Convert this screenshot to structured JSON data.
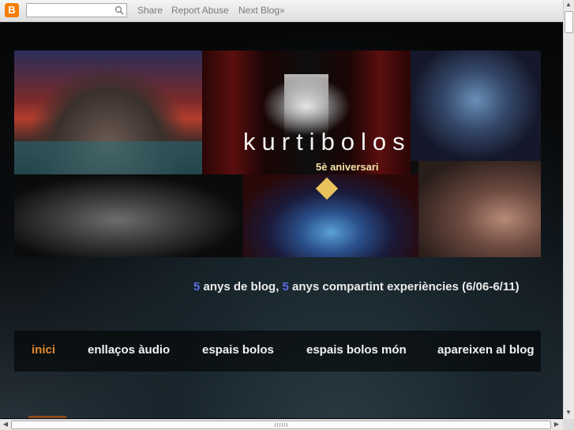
{
  "navbar": {
    "logo_letter": "B",
    "search_placeholder": "",
    "links": [
      "Share",
      "Report Abuse",
      "Next Blog»"
    ]
  },
  "header": {
    "title": "kurtibolos",
    "subtitle": "5è aniversari"
  },
  "tagline": {
    "num1": "5",
    "part1": " anys de blog, ",
    "num2": "5",
    "part2": " anys compartint experiències (6/06-6/11)"
  },
  "tabs": [
    {
      "label": "inici",
      "active": true
    },
    {
      "label": "enllaços àudio",
      "active": false
    },
    {
      "label": "espais bolos",
      "active": false
    },
    {
      "label": "espais bolos món",
      "active": false
    },
    {
      "label": "apareixen al blog",
      "active": false
    }
  ],
  "colors": {
    "accent_active_tab": "#e68a2e",
    "tagline_number": "#5a6be0",
    "blogger_orange": "#f57d00"
  }
}
